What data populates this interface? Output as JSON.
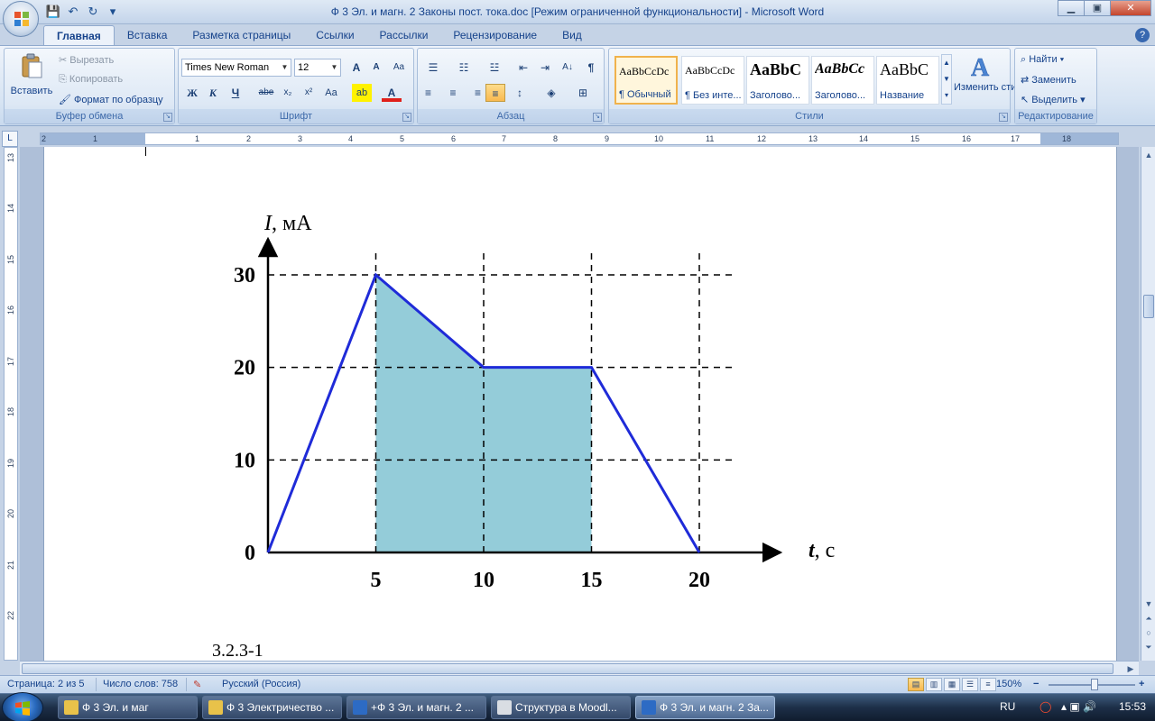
{
  "window": {
    "title": "Ф 3 Эл. и магн. 2 Законы пост. тока.doc [Режим ограниченной функциональности]  -  Microsoft Word",
    "controls": {
      "minimize": "▁",
      "maximize": "▣",
      "close": "✕"
    }
  },
  "quick_access": {
    "save_icon": "💾",
    "undo_icon": "↶",
    "redo_icon": "↻",
    "more_icon": "▾"
  },
  "tabs": [
    "Главная",
    "Вставка",
    "Разметка страницы",
    "Ссылки",
    "Рассылки",
    "Рецензирование",
    "Вид"
  ],
  "active_tab": "Главная",
  "help_icon": "?",
  "clipboard": {
    "paste": "Вставить",
    "cut": "Вырезать",
    "copy": "Копировать",
    "format_painter": "Формат по образцу",
    "label": "Буфер обмена"
  },
  "font": {
    "name": "Times New Roman",
    "size": "12",
    "grow": "A",
    "shrink": "A",
    "clear": "Aa",
    "bold": "Ж",
    "italic": "К",
    "underline": "Ч",
    "strike": "abe",
    "subscript": "x₂",
    "superscript": "x²",
    "case": "Aa",
    "highlight": "ab",
    "font_color": "A",
    "label": "Шрифт"
  },
  "paragraph": {
    "bullets": "☰",
    "numbering": "☷",
    "multilevel": "☳",
    "outdent": "⇤",
    "indent": "⇥",
    "sort": "A↓",
    "show_marks": "¶",
    "align_left": "≡",
    "align_center": "≡",
    "align_right": "≡",
    "justify": "≡",
    "line_spacing": "↕",
    "shading": "◈",
    "borders": "⊞",
    "label": "Абзац"
  },
  "styles": {
    "items": [
      {
        "sample": "AaBbCcDc",
        "name": "¶ Обычный"
      },
      {
        "sample": "AaBbCcDc",
        "name": "¶ Без инте..."
      },
      {
        "sample": "AaBbC",
        "name": "Заголово..."
      },
      {
        "sample": "AaBbCc",
        "name": "Заголово..."
      },
      {
        "sample": "AaBbC",
        "name": "Название"
      }
    ],
    "change": "Изменить стили",
    "label": "Стили"
  },
  "editing": {
    "find": "Найти",
    "replace": "Заменить",
    "select": "Выделить",
    "label": "Редактирование"
  },
  "ruler": {
    "corner": "L",
    "h_numbers": [
      "2",
      "1",
      "1",
      "2",
      "3",
      "4",
      "5",
      "6",
      "7",
      "8",
      "9",
      "10",
      "11",
      "12",
      "13",
      "14",
      "15",
      "16",
      "17",
      "18"
    ],
    "v_numbers": [
      "13",
      "14",
      "15",
      "16",
      "17",
      "18",
      "19",
      "20",
      "21",
      "22"
    ]
  },
  "chart_data": {
    "type": "line",
    "ylabel_var": "I",
    "ylabel_unit": ", мА",
    "xlabel_var": "t",
    "xlabel_unit": ", с",
    "x_ticks": [
      "5",
      "10",
      "15",
      "20"
    ],
    "y_ticks": [
      "0",
      "10",
      "20",
      "30"
    ],
    "xlim": [
      0,
      20
    ],
    "ylim": [
      0,
      30
    ],
    "x": [
      0,
      5,
      10,
      15,
      20
    ],
    "y": [
      0,
      30,
      20,
      20,
      0
    ],
    "shaded_region_x": [
      5,
      15
    ],
    "line_color": "#1f2bd8",
    "fill_color": "#94ccd9",
    "grid": "dashed"
  },
  "caption": "3.2.3-1",
  "status": {
    "page": "Страница: 2 из 5",
    "words": "Число слов: 758",
    "language": "Русский (Россия)",
    "zoom": "150%",
    "zoom_minus": "−",
    "zoom_plus": "+"
  },
  "taskbar": {
    "items": [
      "Ф 3 Эл. и маг",
      "Ф 3 Электричество ...",
      "+Ф 3 Эл. и магн. 2 ...",
      "Структура в Moodl...",
      "Ф 3 Эл. и магн. 2 За..."
    ],
    "lang": "RU",
    "time": "15:53"
  }
}
